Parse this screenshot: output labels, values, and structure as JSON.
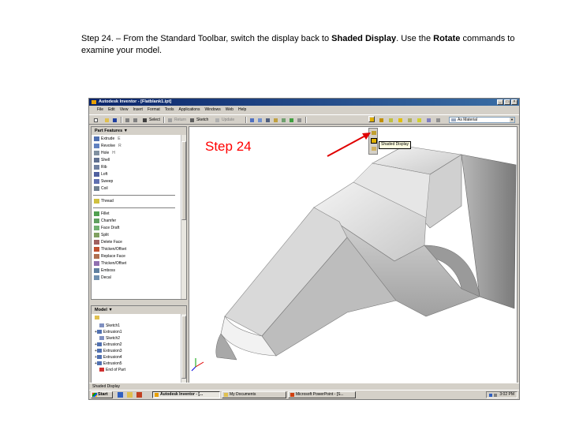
{
  "caption": {
    "part1": "Step 24. – From the Standard Toolbar, switch the display back to ",
    "bold1": "Shaded Display",
    "part2": ". Use the ",
    "bold2": "Rotate",
    "part3": " commands to examine your model."
  },
  "window": {
    "title": "Autodesk Inventor - [Flatblank1.ipt]"
  },
  "menu": [
    "File",
    "Edit",
    "View",
    "Insert",
    "Format",
    "Tools",
    "Applications",
    "Windows",
    "Web",
    "Help"
  ],
  "toolbar": {
    "select_label": "Select",
    "return_label": "Return",
    "sketch_label": "Sketch",
    "update_label": "Update",
    "material_value": "As Material"
  },
  "panel": {
    "title": "Part Features ▼",
    "features": [
      {
        "label": "Extrude",
        "shortcut": "E"
      },
      {
        "label": "Revolve",
        "shortcut": "R"
      },
      {
        "label": "Hole",
        "shortcut": "H"
      },
      {
        "label": "Shell",
        "shortcut": ""
      },
      {
        "label": "Rib",
        "shortcut": ""
      },
      {
        "label": "Loft",
        "shortcut": ""
      },
      {
        "label": "Sweep",
        "shortcut": ""
      },
      {
        "label": "Coil",
        "shortcut": ""
      },
      {
        "label": "Thread",
        "shortcut": ""
      },
      {
        "label": "Fillet",
        "shortcut": ""
      },
      {
        "label": "Chamfer",
        "shortcut": ""
      },
      {
        "label": "Face Draft",
        "shortcut": ""
      },
      {
        "label": "Split",
        "shortcut": ""
      },
      {
        "label": "Delete Face",
        "shortcut": ""
      },
      {
        "label": "Thicken/Offset",
        "shortcut": ""
      },
      {
        "label": "Replace Face",
        "shortcut": ""
      },
      {
        "label": "Emboss",
        "shortcut": ""
      },
      {
        "label": "Decal",
        "shortcut": ""
      }
    ]
  },
  "browser": {
    "title": "Model ▼",
    "items": [
      "Sketch1",
      "Extrusion1",
      "Sketch2",
      "Extrusion2",
      "Extrusion3",
      "Extrusion4",
      "Extrusion5",
      "End of Part"
    ]
  },
  "viewport": {
    "annotation": "Step 24",
    "annotation_color": "#ff0000"
  },
  "tooltip": "Shaded Display",
  "statusbar": "Shaded Display",
  "taskbar": {
    "start": "Start",
    "tasks": [
      "Autodesk Inventor - [...",
      "My Documents",
      "Microsoft PowerPoint - [S..."
    ],
    "clock": "3:02 PM"
  }
}
